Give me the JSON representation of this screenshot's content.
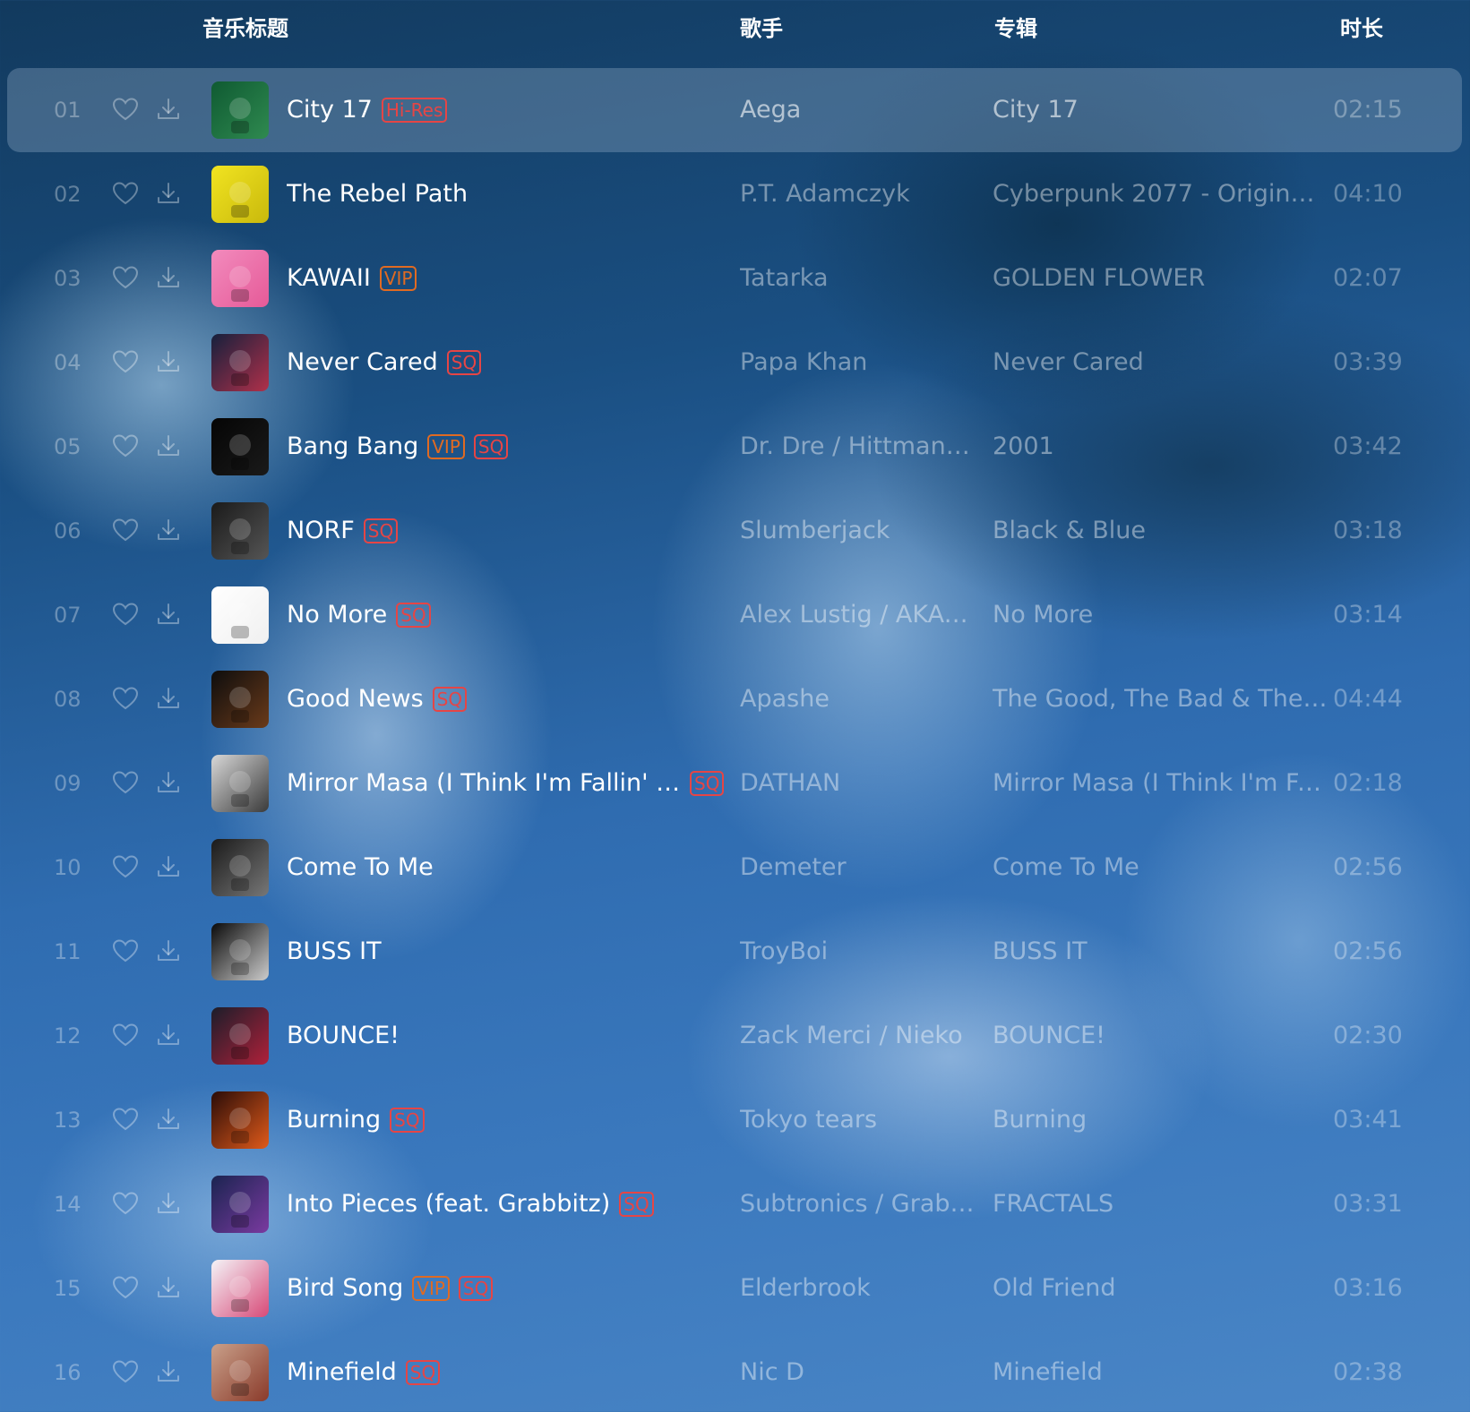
{
  "header": {
    "title_col": "音乐标题",
    "artist_col": "歌手",
    "album_col": "专辑",
    "duration_col": "时长"
  },
  "colors": {
    "sq_tag": "#e64545",
    "vip_tag": "#e06a22",
    "hires_tag": "#e64545",
    "active_row": "rgba(150,175,200,0.35)"
  },
  "tracks": [
    {
      "index": "01",
      "title": "City 17",
      "tags": [
        {
          "type": "hires",
          "label": "Hi-Res"
        }
      ],
      "artist": "Aega",
      "album": "City 17",
      "duration": "02:15",
      "active": true,
      "cover_colors": [
        "#0f5a32",
        "#2f8a50"
      ],
      "cover_icon": "skull-art"
    },
    {
      "index": "02",
      "title": "The Rebel Path",
      "tags": [],
      "artist": "P.T. Adamczyk",
      "album": "Cyberpunk 2077 - Original S...",
      "duration": "04:10",
      "active": false,
      "cover_colors": [
        "#f1e421",
        "#c9b90c"
      ],
      "cover_icon": "cyberpunk-art"
    },
    {
      "index": "03",
      "title": "KAWAII",
      "tags": [
        {
          "type": "vip",
          "label": "VIP"
        }
      ],
      "artist": "Tatarka",
      "album": "GOLDEN FLOWER",
      "duration": "02:07",
      "active": false,
      "cover_colors": [
        "#f28bbd",
        "#e65a98"
      ],
      "cover_icon": "golden-flower-art"
    },
    {
      "index": "04",
      "title": "Never Cared",
      "tags": [
        {
          "type": "sq",
          "label": "SQ"
        }
      ],
      "artist": "Papa Khan",
      "album": "Never Cared",
      "duration": "03:39",
      "active": false,
      "cover_colors": [
        "#15203c",
        "#b0304a"
      ],
      "cover_icon": "figure-art"
    },
    {
      "index": "05",
      "title": "Bang Bang",
      "tags": [
        {
          "type": "vip",
          "label": "VIP"
        },
        {
          "type": "sq",
          "label": "SQ"
        }
      ],
      "artist": "Dr. Dre / Hittman / ...",
      "album": "2001",
      "duration": "03:42",
      "active": false,
      "cover_colors": [
        "#050505",
        "#1a1a1a"
      ],
      "cover_icon": "leaf-art"
    },
    {
      "index": "06",
      "title": "NORF",
      "tags": [
        {
          "type": "sq",
          "label": "SQ"
        }
      ],
      "artist": "Slumberjack",
      "album": "Black & Blue",
      "duration": "03:18",
      "active": false,
      "cover_colors": [
        "#1a1a1a",
        "#555555"
      ],
      "cover_icon": "faces-art"
    },
    {
      "index": "07",
      "title": "No More",
      "tags": [
        {
          "type": "sq",
          "label": "SQ"
        }
      ],
      "artist": "Alex Lustig / AKACI...",
      "album": "No More",
      "duration": "03:14",
      "active": false,
      "cover_colors": [
        "#ffffff",
        "#f0f0f0"
      ],
      "cover_icon": "minimal-art"
    },
    {
      "index": "08",
      "title": "Good News",
      "tags": [
        {
          "type": "sq",
          "label": "SQ"
        }
      ],
      "artist": "Apashe",
      "album": "The Good, The Bad & The F...",
      "duration": "04:44",
      "active": false,
      "cover_colors": [
        "#0d0d0d",
        "#6a3a1a"
      ],
      "cover_icon": "mask-art"
    },
    {
      "index": "09",
      "title": "Mirror Masa (I Think I'm Fallin' for ...",
      "tags": [
        {
          "type": "sq",
          "label": "SQ"
        }
      ],
      "artist": "DATHAN",
      "album": "Mirror Masa (I Think I'm Falli...",
      "duration": "02:18",
      "active": false,
      "cover_colors": [
        "#d8d8d8",
        "#3a3a3a"
      ],
      "cover_icon": "portrait-art"
    },
    {
      "index": "10",
      "title": "Come To Me",
      "tags": [],
      "artist": "Demeter",
      "album": "Come To Me",
      "duration": "02:56",
      "active": false,
      "cover_colors": [
        "#1a1a1a",
        "#777777"
      ],
      "cover_icon": "figure-art"
    },
    {
      "index": "11",
      "title": "BUSS IT",
      "tags": [],
      "artist": "TroyBoi",
      "album": "BUSS IT",
      "duration": "02:56",
      "active": false,
      "cover_colors": [
        "#0a0a0a",
        "#cccccc"
      ],
      "cover_icon": "star-art"
    },
    {
      "index": "12",
      "title": "BOUNCE!",
      "tags": [],
      "artist": "Zack Merci / Nieko",
      "album": "BOUNCE!",
      "duration": "02:30",
      "active": false,
      "cover_colors": [
        "#1b1e2a",
        "#b0203a"
      ],
      "cover_icon": "bounce-art"
    },
    {
      "index": "13",
      "title": "Burning",
      "tags": [
        {
          "type": "sq",
          "label": "SQ"
        }
      ],
      "artist": "Tokyo tears",
      "album": "Burning",
      "duration": "03:41",
      "active": false,
      "cover_colors": [
        "#2a0c08",
        "#e05a1a"
      ],
      "cover_icon": "fire-art"
    },
    {
      "index": "14",
      "title": "Into Pieces (feat. Grabbitz)",
      "tags": [
        {
          "type": "sq",
          "label": "SQ"
        }
      ],
      "artist": "Subtronics / Grabbitz",
      "album": "FRACTALS",
      "duration": "03:31",
      "active": false,
      "cover_colors": [
        "#1a2450",
        "#7a3aa0"
      ],
      "cover_icon": "fractal-art"
    },
    {
      "index": "15",
      "title": "Bird Song",
      "tags": [
        {
          "type": "vip",
          "label": "VIP"
        },
        {
          "type": "sq",
          "label": "SQ"
        }
      ],
      "artist": "Elderbrook",
      "album": "Old Friend",
      "duration": "03:16",
      "active": false,
      "cover_colors": [
        "#f4f4f8",
        "#d84a78"
      ],
      "cover_icon": "bird-art"
    },
    {
      "index": "16",
      "title": "Minefield",
      "tags": [
        {
          "type": "sq",
          "label": "SQ"
        }
      ],
      "artist": "Nic D",
      "album": "Minefield",
      "duration": "02:38",
      "active": false,
      "cover_colors": [
        "#c9a08a",
        "#8a3a2a"
      ],
      "cover_icon": "figure-art"
    }
  ]
}
